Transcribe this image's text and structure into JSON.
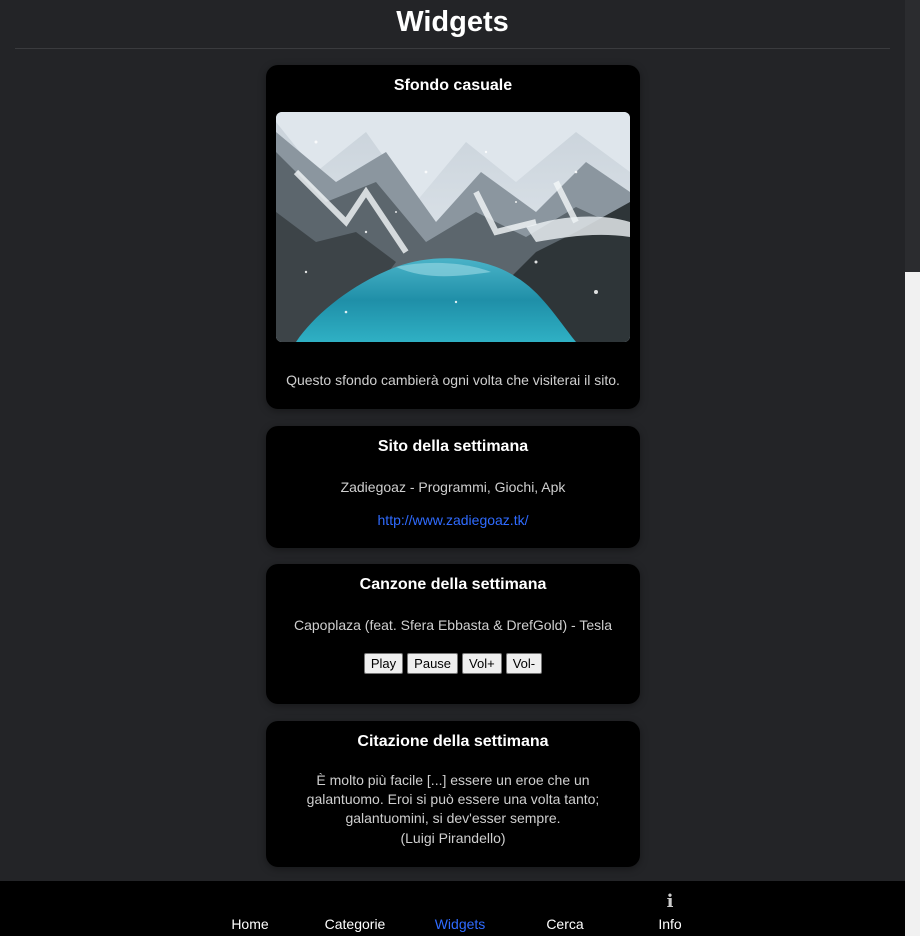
{
  "page": {
    "title": "Widgets"
  },
  "background_widget": {
    "title": "Sfondo casuale",
    "caption": "Questo sfondo cambierà ogni volta che visiterai il sito."
  },
  "site_widget": {
    "title": "Sito della settimana",
    "name": "Zadiegoaz - Programmi, Giochi, Apk",
    "link": "http://www.zadiegoaz.tk/"
  },
  "song_widget": {
    "title": "Canzone della settimana",
    "song": "Capoplaza (feat. Sfera Ebbasta & DrefGold) - Tesla",
    "buttons": {
      "play": "Play",
      "pause": "Pause",
      "vol_up": "Vol+",
      "vol_down": "Vol-"
    }
  },
  "quote_widget": {
    "title": "Citazione della settimana",
    "quote": "È molto più facile [...] essere un eroe che un galantuomo. Eroi si può essere una volta tanto; galantuomini, si dev'esser sempre.",
    "author": "(Luigi Pirandello)"
  },
  "nav": {
    "items": [
      {
        "label": "Home"
      },
      {
        "label": "Categorie"
      },
      {
        "label": "Widgets"
      },
      {
        "label": "Cerca"
      },
      {
        "label": "Info"
      }
    ],
    "active": "Widgets",
    "info_icon": "info-icon"
  },
  "colors": {
    "background": "#232427",
    "card": "#000000",
    "link": "#2f6bff"
  }
}
